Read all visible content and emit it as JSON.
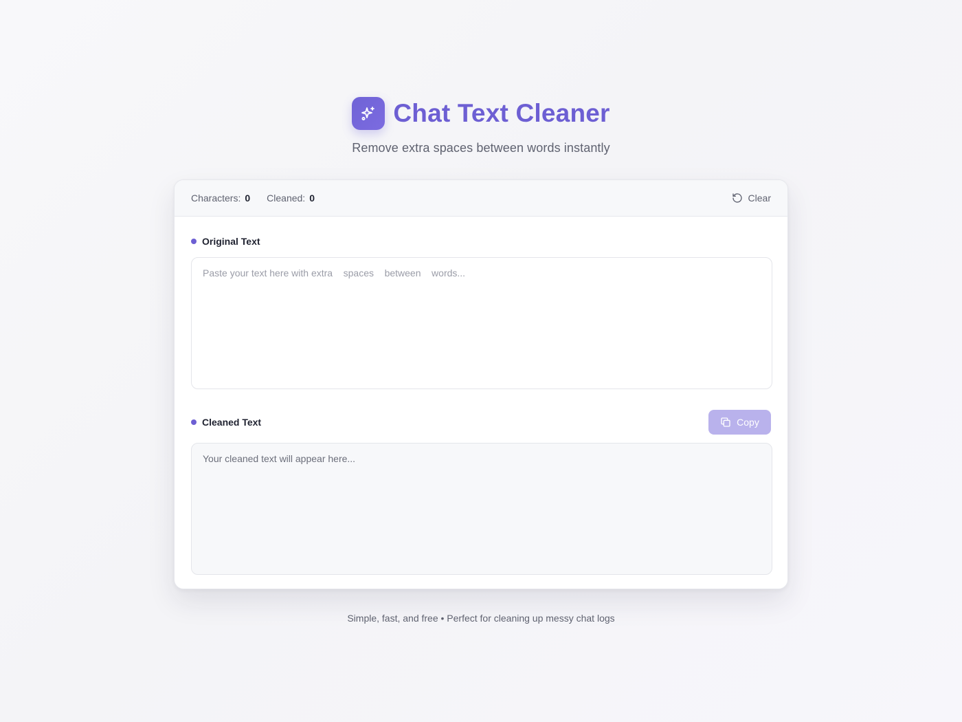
{
  "app": {
    "title": "Chat Text Cleaner",
    "subtitle": "Remove extra spaces between words instantly",
    "logo_icon": "sparkles-icon",
    "accent_color": "#6d5fd3"
  },
  "stats": {
    "characters_label": "Characters:",
    "characters_value": "0",
    "cleaned_label": "Cleaned:",
    "cleaned_value": "0"
  },
  "actions": {
    "clear_label": "Clear",
    "clear_icon": "rotate-ccw-icon",
    "copy_label": "Copy",
    "copy_icon": "copy-icon"
  },
  "input": {
    "label": "Original Text",
    "value": "",
    "placeholder": "Paste your text here with extra    spaces    between    words..."
  },
  "output": {
    "label": "Cleaned Text",
    "placeholder": "Your cleaned text will appear here..."
  },
  "footer": {
    "text": "Simple, fast, and free • Perfect for cleaning up messy chat logs"
  }
}
